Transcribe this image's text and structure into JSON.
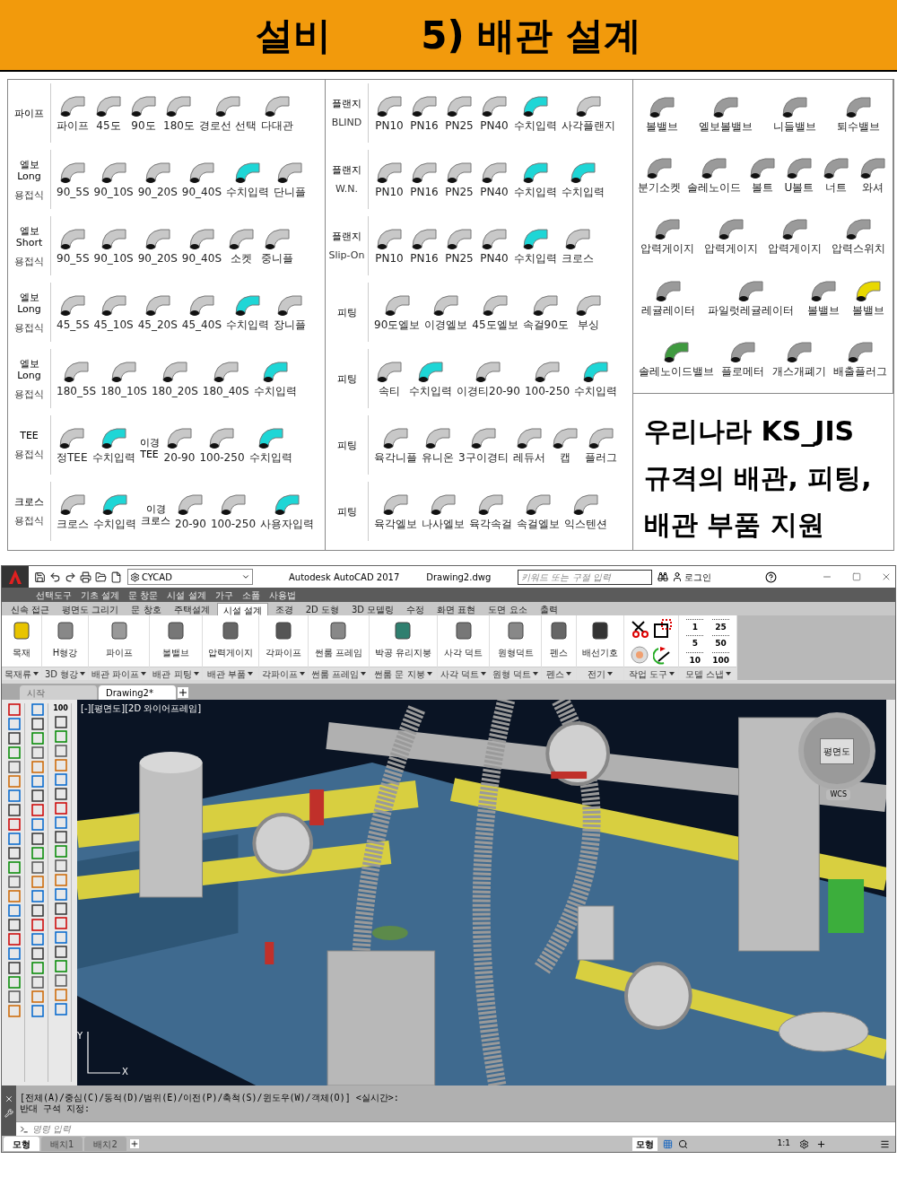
{
  "banner": {
    "title_parts": [
      "설비",
      "5) 배관 설계"
    ]
  },
  "catalog": {
    "panels": [
      {
        "rows": [
          {
            "label": [
              "파이프"
            ],
            "items": [
              {
                "kind": "part",
                "label": "파이프",
                "color": "#c8c8c8"
              },
              {
                "kind": "part",
                "label": "45도",
                "color": "#c8c8c8"
              },
              {
                "kind": "part",
                "label": "90도",
                "color": "#c8c8c8"
              },
              {
                "kind": "part",
                "label": "180도",
                "color": "#c8c8c8"
              },
              {
                "kind": "part",
                "label": "경로선 선택",
                "color": "#c8c8c8"
              },
              {
                "kind": "part",
                "label": "다대관",
                "color": "#c8c8c8"
              }
            ]
          },
          {
            "label": [
              "엘보",
              "Long",
              "용접식"
            ],
            "items": [
              {
                "kind": "part",
                "label": "90_5S",
                "color": "#c8c8c8"
              },
              {
                "kind": "part",
                "label": "90_10S",
                "color": "#c8c8c8"
              },
              {
                "kind": "part",
                "label": "90_20S",
                "color": "#c8c8c8"
              },
              {
                "kind": "part",
                "label": "90_40S",
                "color": "#c8c8c8"
              },
              {
                "kind": "part",
                "label": "수치입력",
                "color": "#1ed6d6"
              },
              {
                "kind": "part",
                "label": "단니플",
                "color": "#c8c8c8"
              }
            ]
          },
          {
            "label": [
              "엘보",
              "Short",
              "용접식"
            ],
            "items": [
              {
                "kind": "part",
                "label": "90_5S",
                "color": "#c8c8c8"
              },
              {
                "kind": "part",
                "label": "90_10S",
                "color": "#c8c8c8"
              },
              {
                "kind": "part",
                "label": "90_20S",
                "color": "#c8c8c8"
              },
              {
                "kind": "part",
                "label": "90_40S",
                "color": "#c8c8c8"
              },
              {
                "kind": "part",
                "label": "소켓",
                "color": "#c8c8c8"
              },
              {
                "kind": "part",
                "label": "중니플",
                "color": "#c8c8c8"
              }
            ]
          },
          {
            "label": [
              "엘보",
              "Long",
              "용접식"
            ],
            "items": [
              {
                "kind": "part",
                "label": "45_5S",
                "color": "#c8c8c8"
              },
              {
                "kind": "part",
                "label": "45_10S",
                "color": "#c8c8c8"
              },
              {
                "kind": "part",
                "label": "45_20S",
                "color": "#c8c8c8"
              },
              {
                "kind": "part",
                "label": "45_40S",
                "color": "#c8c8c8"
              },
              {
                "kind": "part",
                "label": "수치입력",
                "color": "#1ed6d6"
              },
              {
                "kind": "part",
                "label": "장니플",
                "color": "#c8c8c8"
              }
            ]
          },
          {
            "label": [
              "엘보",
              "Long",
              "용접식"
            ],
            "items": [
              {
                "kind": "part",
                "label": "180_5S",
                "color": "#c8c8c8"
              },
              {
                "kind": "part",
                "label": "180_10S",
                "color": "#c8c8c8"
              },
              {
                "kind": "part",
                "label": "180_20S",
                "color": "#c8c8c8"
              },
              {
                "kind": "part",
                "label": "180_40S",
                "color": "#c8c8c8"
              },
              {
                "kind": "part",
                "label": "수치입력",
                "color": "#1ed6d6"
              }
            ]
          },
          {
            "label": [
              "TEE",
              "용접식"
            ],
            "items": [
              {
                "kind": "part",
                "label": "정TEE",
                "color": "#c8c8c8"
              },
              {
                "kind": "part",
                "label": "수치입력",
                "color": "#1ed6d6"
              },
              {
                "kind": "group",
                "lines": [
                  "이경",
                  "TEE"
                ]
              },
              {
                "kind": "part",
                "label": "20-90",
                "color": "#c8c8c8"
              },
              {
                "kind": "part",
                "label": "100-250",
                "color": "#c8c8c8"
              },
              {
                "kind": "part",
                "label": "수치입력",
                "color": "#1ed6d6"
              }
            ]
          },
          {
            "label": [
              "크로스",
              "용접식"
            ],
            "items": [
              {
                "kind": "part",
                "label": "크로스",
                "color": "#c8c8c8"
              },
              {
                "kind": "part",
                "label": "수치입력",
                "color": "#1ed6d6"
              },
              {
                "kind": "group",
                "lines": [
                  "이경",
                  "크로스"
                ]
              },
              {
                "kind": "part",
                "label": "20-90",
                "color": "#c8c8c8"
              },
              {
                "kind": "part",
                "label": "100-250",
                "color": "#c8c8c8"
              },
              {
                "kind": "part",
                "label": "사용자입력",
                "color": "#1ed6d6"
              }
            ]
          }
        ]
      },
      {
        "rows": [
          {
            "label": [
              "플랜지",
              "BLIND"
            ],
            "items": [
              {
                "kind": "part",
                "label": "PN10",
                "color": "#c8c8c8"
              },
              {
                "kind": "part",
                "label": "PN16",
                "color": "#c8c8c8"
              },
              {
                "kind": "part",
                "label": "PN25",
                "color": "#c8c8c8"
              },
              {
                "kind": "part",
                "label": "PN40",
                "color": "#c8c8c8"
              },
              {
                "kind": "part",
                "label": "수치입력",
                "color": "#1ed6d6"
              },
              {
                "kind": "part",
                "label": "사각플랜지",
                "color": "#c8c8c8"
              }
            ]
          },
          {
            "label": [
              "플랜지",
              "W.N."
            ],
            "items": [
              {
                "kind": "part",
                "label": "PN10",
                "color": "#c8c8c8"
              },
              {
                "kind": "part",
                "label": "PN16",
                "color": "#c8c8c8"
              },
              {
                "kind": "part",
                "label": "PN25",
                "color": "#c8c8c8"
              },
              {
                "kind": "part",
                "label": "PN40",
                "color": "#c8c8c8"
              },
              {
                "kind": "part",
                "label": "수치입력",
                "color": "#1ed6d6"
              },
              {
                "kind": "part",
                "label": "수치입력",
                "color": "#1ed6d6"
              }
            ]
          },
          {
            "label": [
              "플랜지",
              "Slip-On"
            ],
            "items": [
              {
                "kind": "part",
                "label": "PN10",
                "color": "#c8c8c8"
              },
              {
                "kind": "part",
                "label": "PN16",
                "color": "#c8c8c8"
              },
              {
                "kind": "part",
                "label": "PN25",
                "color": "#c8c8c8"
              },
              {
                "kind": "part",
                "label": "PN40",
                "color": "#c8c8c8"
              },
              {
                "kind": "part",
                "label": "수치입력",
                "color": "#1ed6d6"
              },
              {
                "kind": "part",
                "label": "크로스",
                "color": "#c8c8c8"
              }
            ]
          },
          {
            "label": [
              "피팅"
            ],
            "items": [
              {
                "kind": "part",
                "label": "90도엘보",
                "color": "#c8c8c8"
              },
              {
                "kind": "part",
                "label": "이경엘보",
                "color": "#c8c8c8"
              },
              {
                "kind": "part",
                "label": "45도엘보",
                "color": "#c8c8c8"
              },
              {
                "kind": "part",
                "label": "속걸90도",
                "color": "#c8c8c8"
              },
              {
                "kind": "part",
                "label": "부싱",
                "color": "#c8c8c8"
              }
            ]
          },
          {
            "label": [
              "피팅"
            ],
            "items": [
              {
                "kind": "part",
                "label": "속티",
                "color": "#c8c8c8"
              },
              {
                "kind": "part",
                "label": "수치입력",
                "color": "#1ed6d6"
              },
              {
                "kind": "part",
                "label": "이경티20-90",
                "color": "#c8c8c8"
              },
              {
                "kind": "part",
                "label": "100-250",
                "color": "#c8c8c8"
              },
              {
                "kind": "part",
                "label": "수치입력",
                "color": "#1ed6d6"
              }
            ]
          },
          {
            "label": [
              "피팅"
            ],
            "items": [
              {
                "kind": "part",
                "label": "육각니플",
                "color": "#c8c8c8"
              },
              {
                "kind": "part",
                "label": "유니온",
                "color": "#c8c8c8"
              },
              {
                "kind": "part",
                "label": "3구이경티",
                "color": "#c8c8c8"
              },
              {
                "kind": "part",
                "label": "레듀서",
                "color": "#c8c8c8"
              },
              {
                "kind": "part",
                "label": "캡",
                "color": "#c8c8c8"
              },
              {
                "kind": "part",
                "label": "플러그",
                "color": "#c8c8c8"
              }
            ]
          },
          {
            "label": [
              "피팅"
            ],
            "items": [
              {
                "kind": "part",
                "label": "육각엘보",
                "color": "#c8c8c8"
              },
              {
                "kind": "part",
                "label": "나사엘보",
                "color": "#c8c8c8"
              },
              {
                "kind": "part",
                "label": "육각속걸",
                "color": "#c8c8c8"
              },
              {
                "kind": "part",
                "label": "속걸엘보",
                "color": "#c8c8c8"
              },
              {
                "kind": "part",
                "label": "익스텐션",
                "color": "#c8c8c8"
              }
            ]
          }
        ]
      }
    ],
    "components": {
      "rows": [
        {
          "items": [
            {
              "label": "볼밸브",
              "color": "#9a9a9a"
            },
            {
              "label": "엘보볼밸브",
              "color": "#9a9a9a"
            },
            {
              "label": "니들밸브",
              "color": "#9a9a9a"
            },
            {
              "label": "퇴수밸브",
              "color": "#9a9a9a"
            }
          ]
        },
        {
          "items": [
            {
              "label": "분기소켓",
              "color": "#9a9a9a"
            },
            {
              "label": "솔레노이드",
              "color": "#9a9a9a"
            },
            {
              "label": "볼트",
              "color": "#9a9a9a"
            },
            {
              "label": "U볼트",
              "color": "#9a9a9a"
            },
            {
              "label": "너트",
              "color": "#9a9a9a"
            },
            {
              "label": "와셔",
              "color": "#9a9a9a"
            }
          ]
        },
        {
          "items": [
            {
              "label": "압력게이지",
              "color": "#9a9a9a"
            },
            {
              "label": "압력게이지",
              "color": "#9a9a9a"
            },
            {
              "label": "압력게이지",
              "color": "#9a9a9a"
            },
            {
              "label": "압력스위치",
              "color": "#9a9a9a"
            }
          ]
        },
        {
          "items": [
            {
              "label": "레귤레이터",
              "color": "#9a9a9a"
            },
            {
              "label": "파일럿레귤레이터",
              "color": "#9a9a9a"
            },
            {
              "label": "볼밸브",
              "color": "#9a9a9a"
            },
            {
              "label": "볼밸브",
              "color": "#e8d800"
            }
          ]
        },
        {
          "items": [
            {
              "label": "솔레노이드밸브",
              "color": "#3f9a3f"
            },
            {
              "label": "플로메터",
              "color": "#9a9a9a"
            },
            {
              "label": "개스개폐기",
              "color": "#9a9a9a"
            },
            {
              "label": "배출플러그",
              "color": "#9a9a9a"
            }
          ]
        }
      ]
    },
    "note": {
      "lines": [
        "우리나라 KS_JIS",
        "규격의 배관, 피팅,",
        "배관 부품 지원"
      ]
    }
  },
  "autocad": {
    "title_bar": {
      "workspace": "CYCAD",
      "app_title": "Autodesk AutoCAD 2017",
      "file_name": "Drawing2.dwg",
      "search": {
        "placeholder": "키워드 또는 구절 입력"
      },
      "sign_in": "로그인"
    },
    "menu_bar": [
      "선택도구",
      "기초 설계",
      "문 창문",
      "시설 설계",
      "가구",
      "소품",
      "사용법"
    ],
    "ribbon_tabs": [
      {
        "label": "신속 접근",
        "selected": false
      },
      {
        "label": "평면도 그리기",
        "selected": false
      },
      {
        "label": "문 창호",
        "selected": false
      },
      {
        "label": "주택설계",
        "selected": false
      },
      {
        "label": "시설 설계",
        "selected": true
      },
      {
        "label": "조경",
        "selected": false
      },
      {
        "label": "2D 도형",
        "selected": false
      },
      {
        "label": "3D 모델링",
        "selected": false
      },
      {
        "label": "수정",
        "selected": false
      },
      {
        "label": "화면 표현",
        "selected": false
      },
      {
        "label": "도면 요소",
        "selected": false
      },
      {
        "label": "출력",
        "selected": false
      }
    ],
    "ribbon_panels": [
      {
        "kind": "buttons",
        "title": "목재류",
        "buttons": [
          "목재"
        ]
      },
      {
        "kind": "buttons",
        "title": "3D 형강",
        "buttons": [
          "H형강"
        ]
      },
      {
        "kind": "buttons",
        "title": "배관 파이프",
        "buttons": [
          "파이프"
        ]
      },
      {
        "kind": "buttons",
        "title": "배관 피팅",
        "buttons": [
          "볼밸브"
        ]
      },
      {
        "kind": "buttons",
        "title": "배관 부품",
        "buttons": [
          "압력게이지"
        ]
      },
      {
        "kind": "buttons",
        "title": "각파이프",
        "buttons": [
          "각파이프"
        ]
      },
      {
        "kind": "buttons",
        "title": "썬룸 프레임",
        "buttons": [
          "썬룸 프레임"
        ]
      },
      {
        "kind": "buttons",
        "title": "썬룸 문 지붕",
        "buttons": [
          "박공 유리지붕"
        ]
      },
      {
        "kind": "buttons",
        "title": "사각 덕트",
        "buttons": [
          "사각 덕트"
        ]
      },
      {
        "kind": "buttons",
        "title": "원형 덕트",
        "buttons": [
          "원형덕트"
        ]
      },
      {
        "kind": "buttons",
        "title": "펜스",
        "buttons": [
          "펜스"
        ]
      },
      {
        "kind": "buttons",
        "title": "전기",
        "buttons": [
          "배선기호"
        ]
      },
      {
        "kind": "tools",
        "title": "작업 도구"
      },
      {
        "kind": "snap",
        "title": "모델 스냅",
        "buttons": [
          "1",
          "25",
          "5",
          "50",
          "10",
          "100"
        ]
      }
    ],
    "file_tabs": [
      {
        "label": "시작",
        "selected": false
      },
      {
        "label": "Drawing2*",
        "selected": true
      }
    ],
    "toolbar_text": "100",
    "viewport": {
      "label": "[-][평면도][2D 와이어프레임]",
      "viewcube_face": "평면도",
      "wcs": "WCS",
      "axis": [
        "Y",
        "X"
      ]
    },
    "command_history": [
      "[전체(A)/중심(C)/동적(D)/범위(E)/이전(P)/축척(S)/윈도우(W)/객체(O)] <실시간>:",
      "반대 구석 지정:"
    ],
    "command_input": {
      "placeholder": "명령 입력"
    },
    "layout_tabs": [
      {
        "label": "모형",
        "selected": true
      },
      {
        "label": "배치1",
        "selected": false
      },
      {
        "label": "배치2",
        "selected": false
      }
    ],
    "status_bar": {
      "space": "모형",
      "scale": "1:1"
    }
  }
}
